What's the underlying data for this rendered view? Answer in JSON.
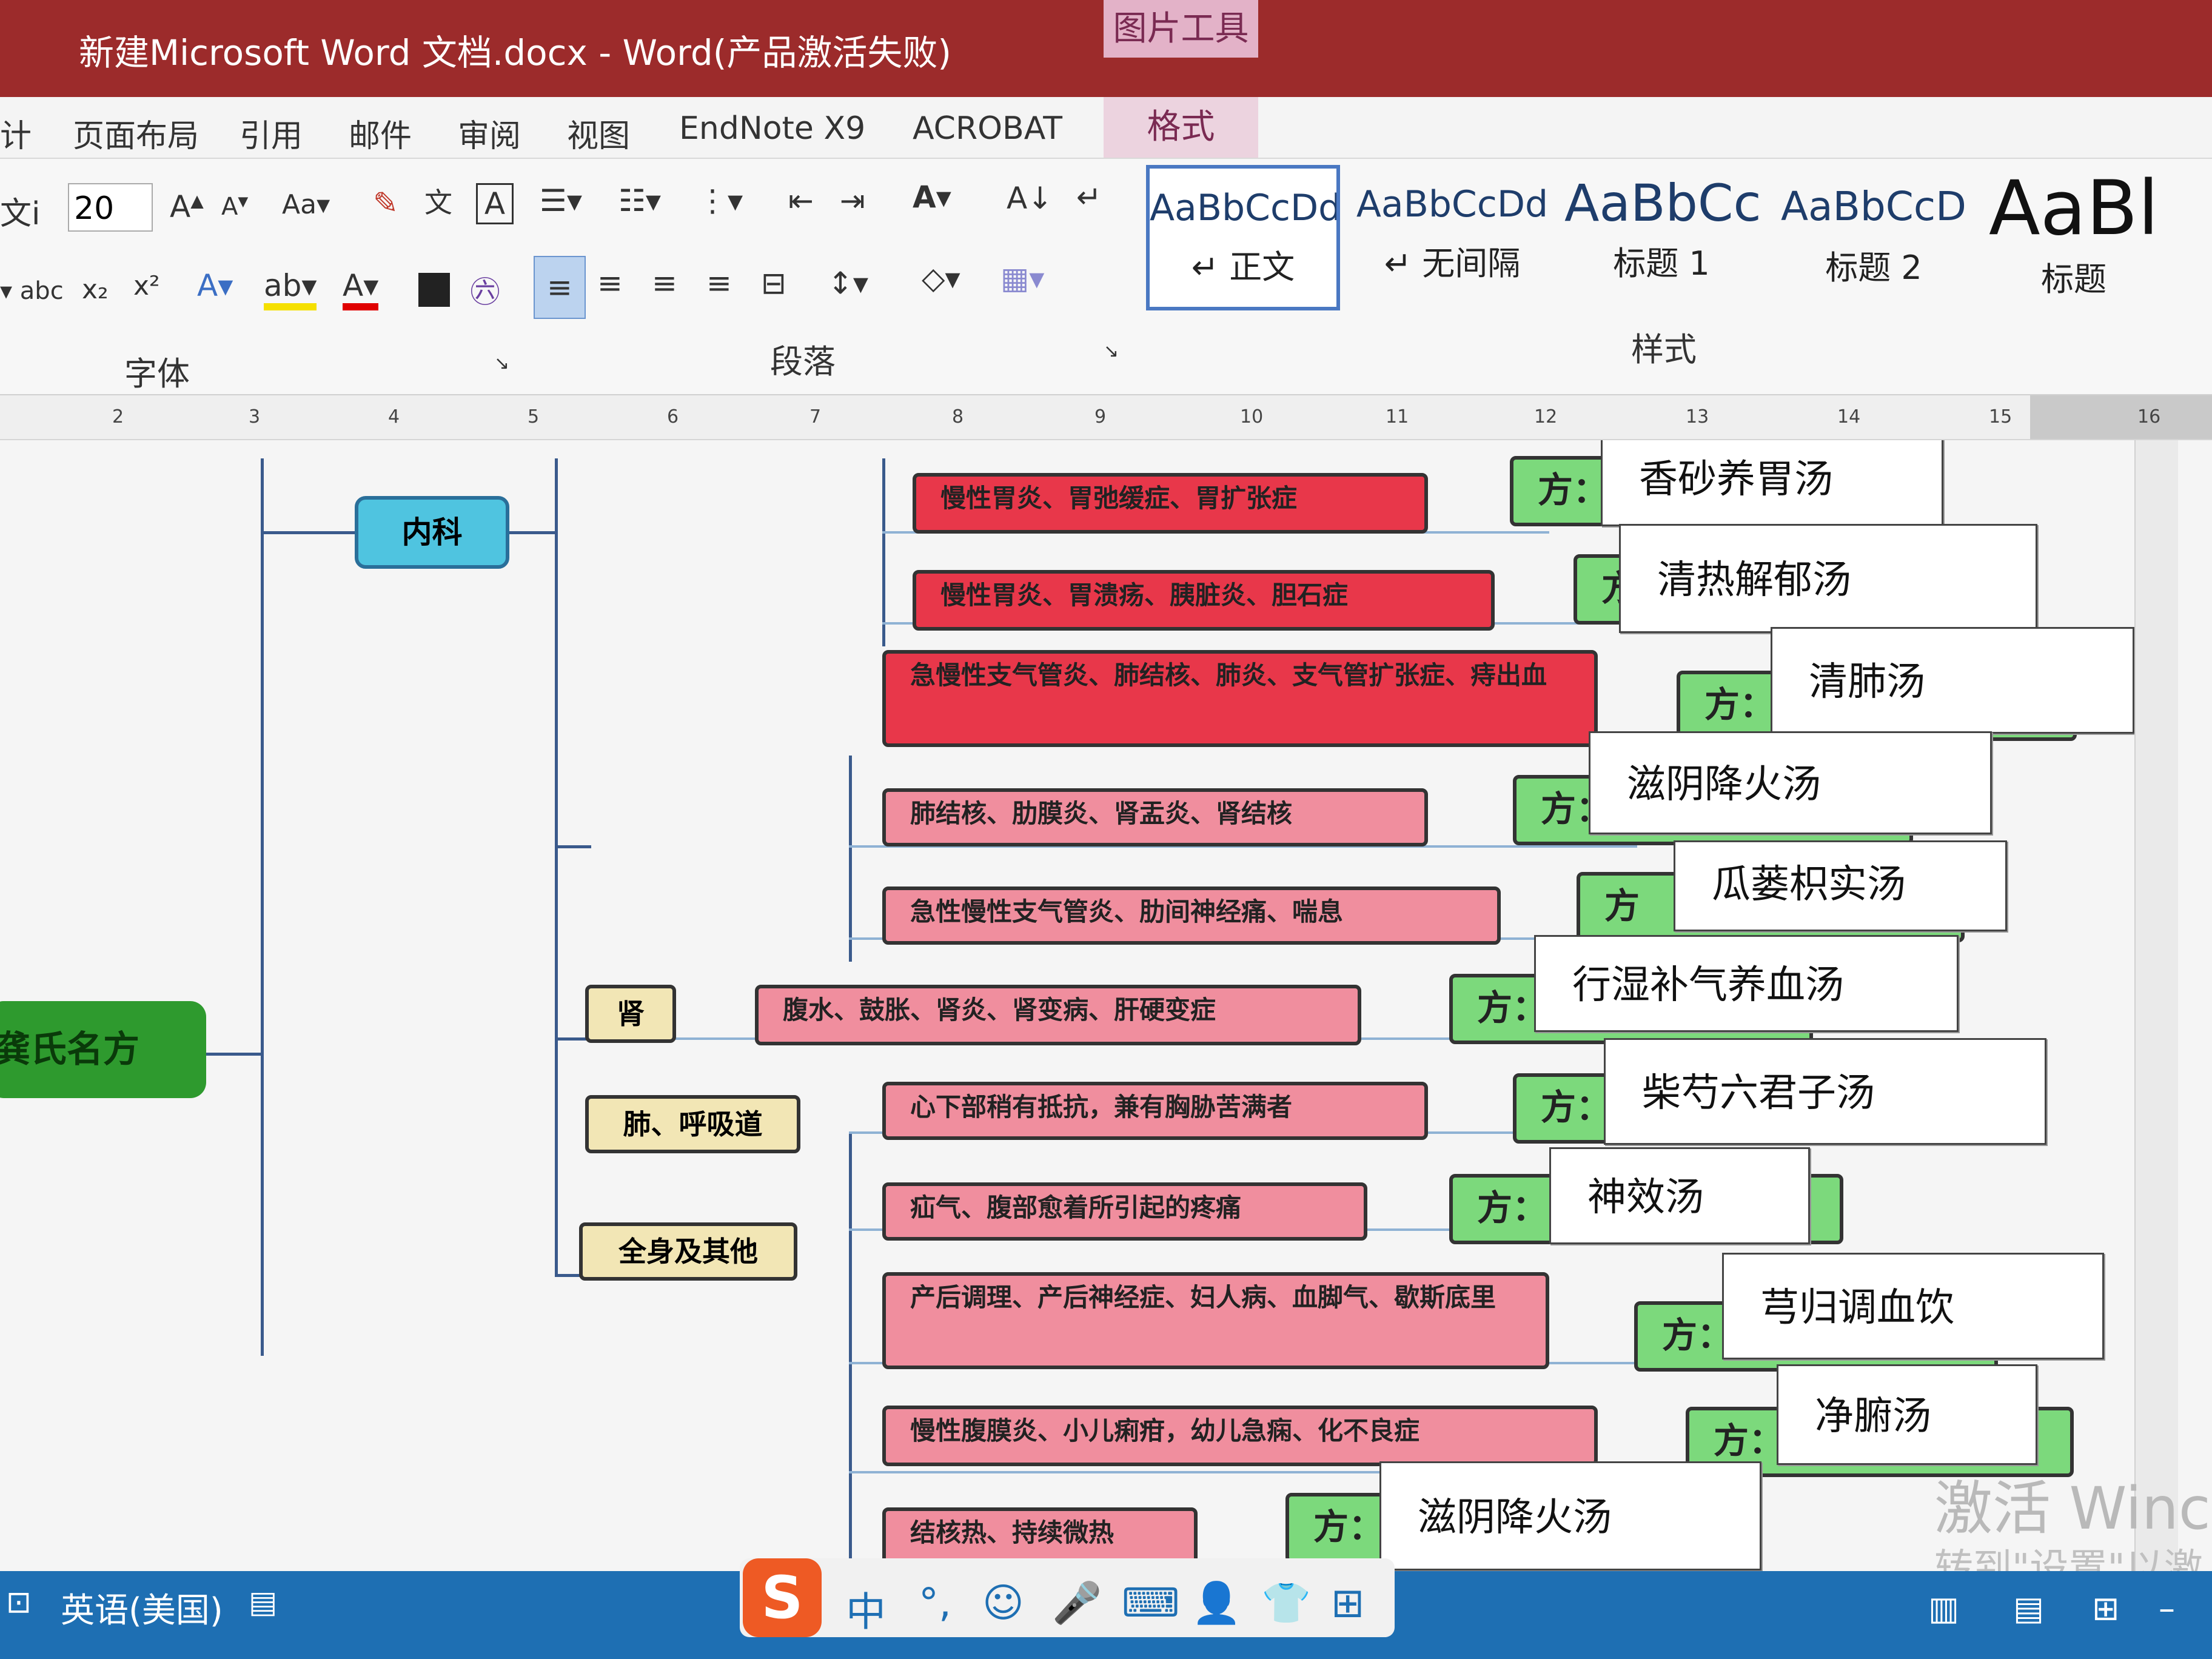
{
  "window": {
    "title": "新建Microsoft Word 文档.docx  -  Word(产品激活失败)",
    "context_tab_group": "图片工具"
  },
  "menu": {
    "tabs": [
      "计",
      "页面布局",
      "引用",
      "邮件",
      "审阅",
      "视图",
      "EndNote X9",
      "ACROBAT"
    ],
    "context_tab": "格式"
  },
  "ribbon": {
    "font": {
      "name_partial": "文i",
      "size": "20",
      "group_label": "字体"
    },
    "paragraph": {
      "group_label": "段落"
    },
    "styles": {
      "group_label": "样式",
      "items": [
        {
          "sample": "AaBbCcDd",
          "name": "正文",
          "selected": true
        },
        {
          "sample": "AaBbCcDd",
          "name": "无间隔",
          "selected": false
        },
        {
          "sample": "AaBbCc",
          "name": "标题 1",
          "selected": false
        },
        {
          "sample": "AaBbCcD",
          "name": "标题 2",
          "selected": false
        },
        {
          "sample": "AaBl",
          "name": "标题",
          "selected": false
        }
      ]
    }
  },
  "ruler": {
    "numbers": [
      "2",
      "3",
      "4",
      "5",
      "6",
      "7",
      "8",
      "9",
      "10",
      "11",
      "12",
      "13",
      "14",
      "15",
      "16"
    ]
  },
  "mindmap": {
    "root": "龚氏名方",
    "dept": "内科",
    "categories": [
      "肺、呼吸道",
      "肾",
      "全身及其他"
    ],
    "symptoms": [
      "慢性胃炎、胃弛缓症、胃扩张症",
      "慢性胃炎、胃溃疡、胰脏炎、胆石症",
      "急慢性支气管炎、肺结核、肺炎、支气管扩张症、痔出血",
      "肺结核、肋膜炎、肾盂炎、肾结核",
      "急性慢性支气管炎、肋间神经痛、喘息",
      "腹水、鼓胀、肾炎、肾变病、肝硬变症",
      "心下部稍有抵抗，兼有胸胁苦满者",
      "疝气、腹部愈着所引起的疼痛",
      "产后调理、产后神经症、妇人病、血脚气、歇斯底里",
      "慢性腹膜炎、小儿痢疳，幼儿急痫、化不良症",
      "结核热、持续微热"
    ],
    "fang_labels": [
      "方：",
      "方",
      "方：",
      "方：",
      "方",
      "方：",
      "方：",
      "方：",
      "方：",
      "方：",
      "方：",
      "方："
    ],
    "prescriptions": [
      "香砂养胃汤",
      "清热解郁汤",
      "清肺汤",
      "滋阴降火汤",
      "瓜蒌枳实汤",
      "行湿补气养血汤",
      "柴芍六君子汤",
      "神效汤",
      "芎归调血饮",
      "净腑汤",
      "滋阴降火汤"
    ]
  },
  "watermark": {
    "line1": "激活 Winc",
    "line2": "转到\"设置\"以激"
  },
  "status": {
    "language": "英语(美国)"
  },
  "ime": {
    "logo": "S",
    "mode": "中"
  },
  "colors": {
    "titlebar": "#9c2b2b",
    "red_node": "#e8374a",
    "pink_node": "#f08e9e",
    "green_node": "#7cd97c",
    "root_node": "#2e9a2e",
    "dept_node": "#4fc4e0"
  }
}
